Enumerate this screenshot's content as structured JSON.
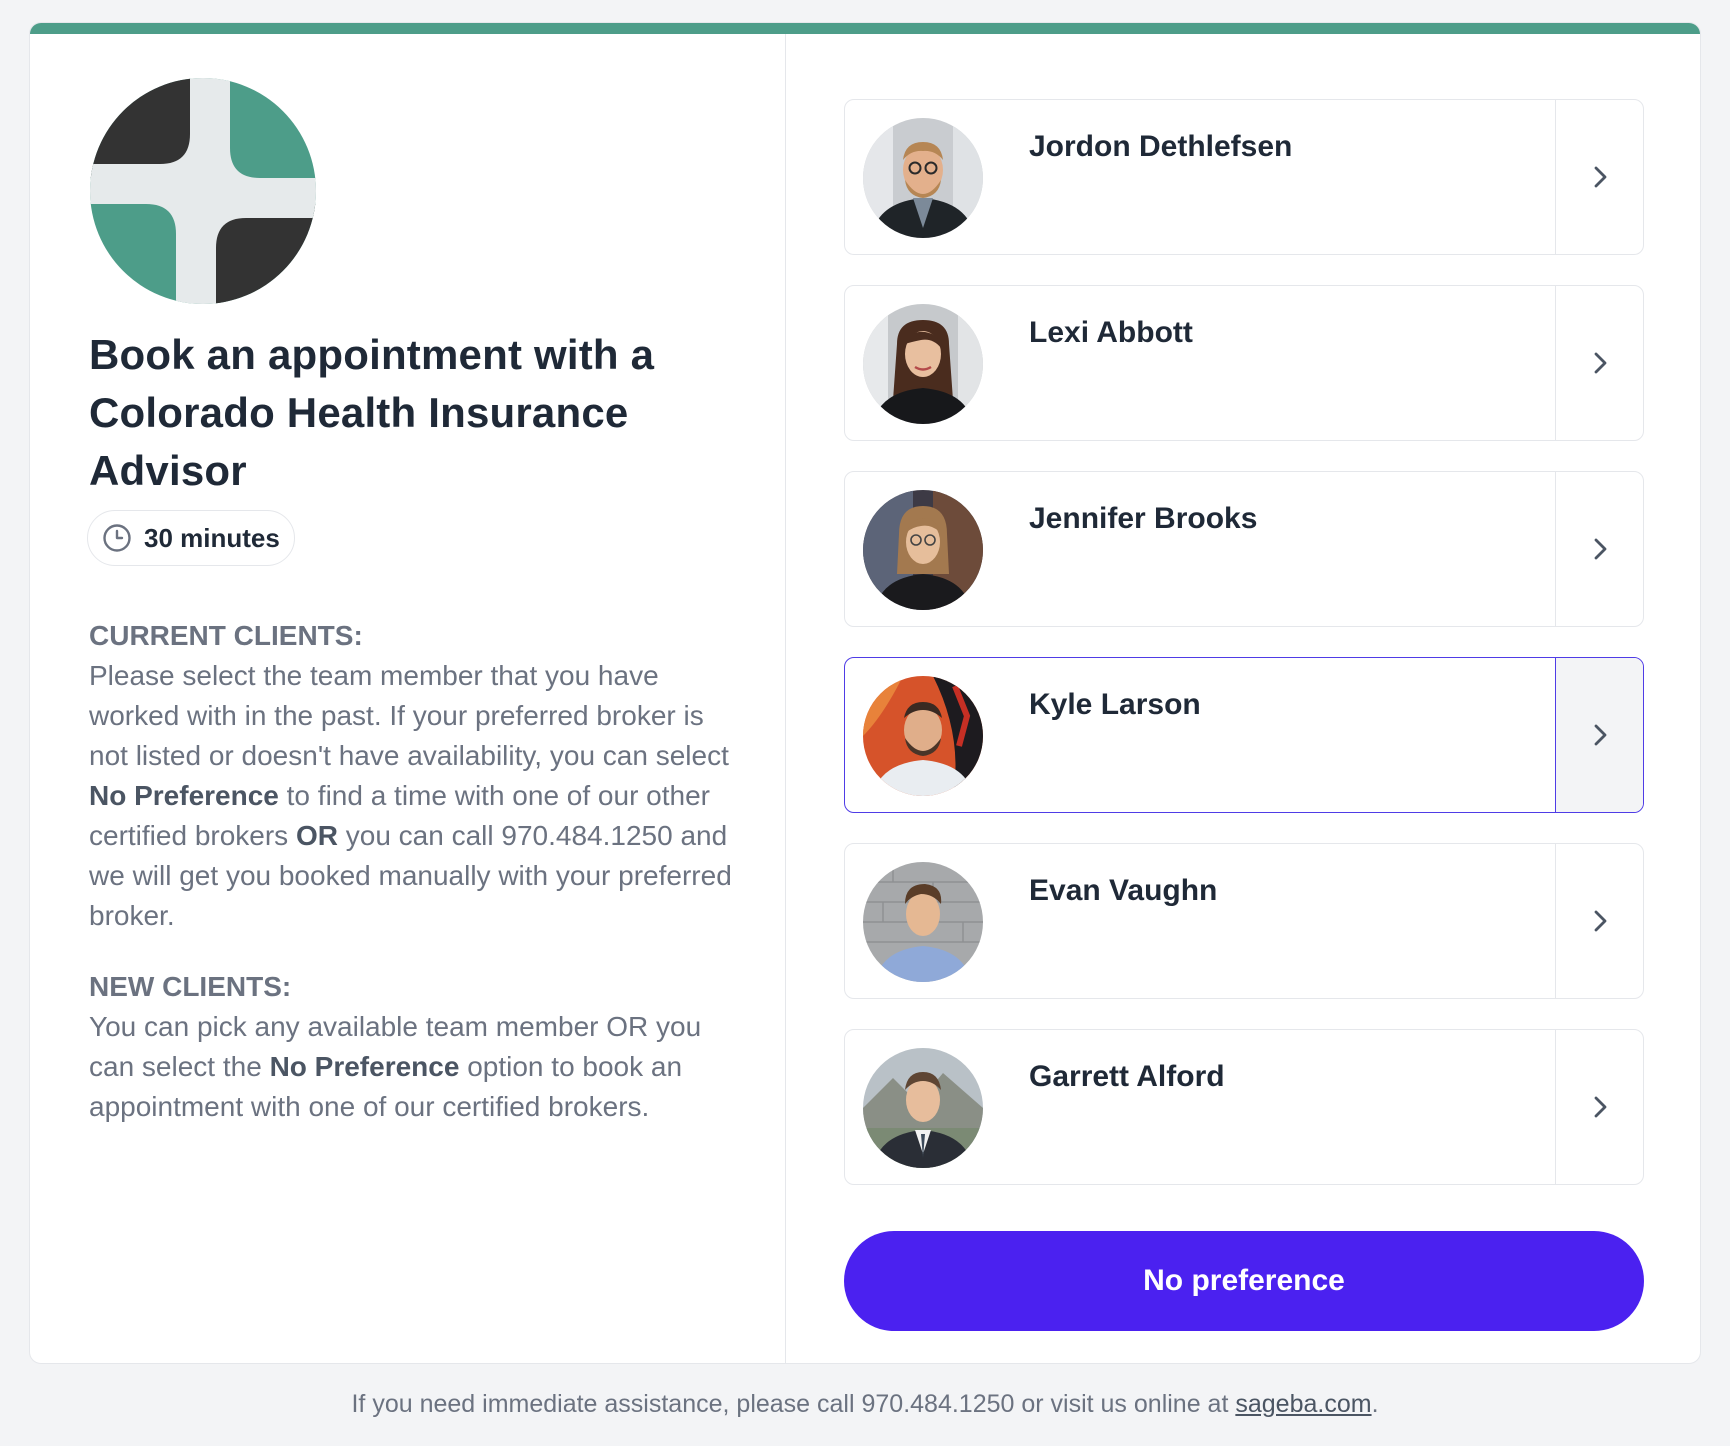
{
  "colors": {
    "accent_green": "#4d9d89",
    "button_purple": "#4b21f0",
    "selected_border": "#4f3ce6",
    "logo_dark": "#333333",
    "logo_light": "#e6eaeb"
  },
  "logo": {
    "icon": "sage-cross-logo-icon"
  },
  "title": "Book an appointment with a Colorado Health Insurance Advisor",
  "duration": {
    "icon": "clock-icon",
    "label": "30 minutes"
  },
  "current_clients": {
    "heading": "CURRENT CLIENTS:",
    "text_1": "Please select the team member that you have worked with in the past. If your preferred broker is not listed or doesn't have availability, you can select ",
    "bold_1": "No Preference",
    "text_2": " to find a time with one of our other certified brokers ",
    "bold_2": "OR",
    "text_3": " you can call 970.484.1250 and we will get you booked manually with your preferred broker."
  },
  "new_clients": {
    "heading": "NEW CLIENTS:",
    "text_1": "You can pick any available team member OR you can select the ",
    "bold_1": "No Preference",
    "text_2": " option to book an appointment with one of our certified brokers."
  },
  "brokers": [
    {
      "name": "Jordon Dethlefsen",
      "selected": false,
      "icon": "chevron-right-icon"
    },
    {
      "name": "Lexi Abbott",
      "selected": false,
      "icon": "chevron-right-icon"
    },
    {
      "name": "Jennifer Brooks",
      "selected": false,
      "icon": "chevron-right-icon"
    },
    {
      "name": "Kyle Larson",
      "selected": true,
      "icon": "chevron-right-icon"
    },
    {
      "name": "Evan Vaughn",
      "selected": false,
      "icon": "chevron-right-icon"
    },
    {
      "name": "Garrett Alford",
      "selected": false,
      "icon": "chevron-right-icon"
    }
  ],
  "no_preference_label": "No preference",
  "footer": {
    "text_before": "If you need immediate assistance, please call 970.484.1250 or visit us online at ",
    "link_text": "sageba.com",
    "text_after": "."
  }
}
